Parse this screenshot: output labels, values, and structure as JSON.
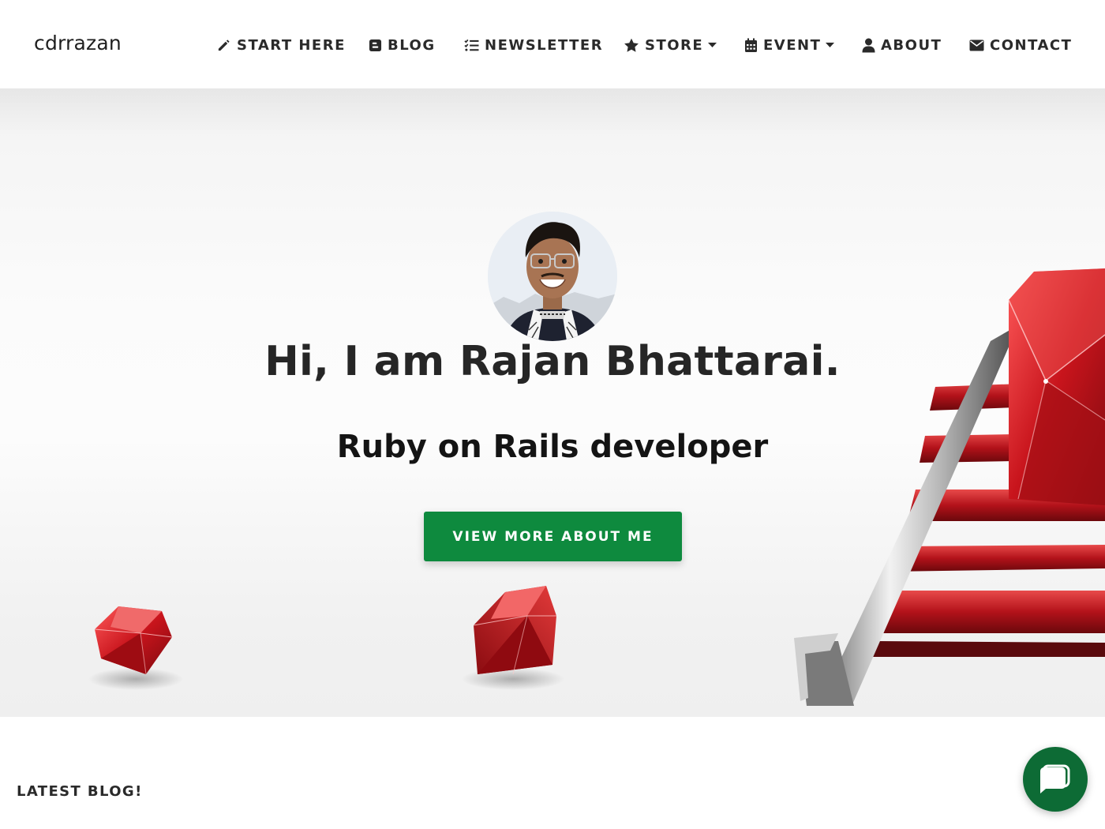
{
  "header": {
    "brand": "cdrrazan",
    "nav": [
      {
        "label": "START HERE",
        "icon": "pencil-icon"
      },
      {
        "label": "BLOG",
        "icon": "blogger-icon"
      },
      {
        "label": "NEWSLETTER",
        "icon": "list-check-icon"
      },
      {
        "label": "STORE",
        "icon": "star-icon",
        "dropdown": true
      },
      {
        "label": "EVENT",
        "icon": "calendar-icon",
        "dropdown": true
      },
      {
        "label": "ABOUT",
        "icon": "user-icon"
      },
      {
        "label": "CONTACT",
        "icon": "envelope-icon"
      }
    ]
  },
  "hero": {
    "headline": "Hi, I am Rajan Bhattarai.",
    "subtitle": "Ruby on Rails developer",
    "cta_label": "VIEW MORE ABOUT ME"
  },
  "sections": {
    "latest_blog_title": "LATEST BLOG!"
  },
  "chat": {
    "icon": "chat-bubble-icon"
  },
  "colors": {
    "accent_green": "#0e8a3e",
    "chat_green": "#0d6b35",
    "ruby_red": "#c0121a"
  }
}
